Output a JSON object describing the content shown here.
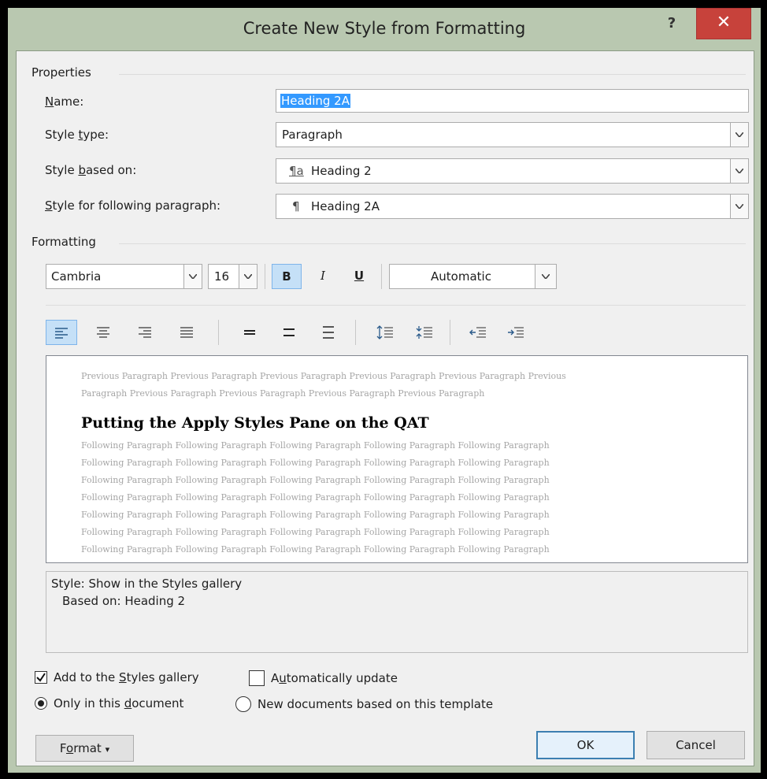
{
  "window": {
    "title": "Create New Style from Formatting",
    "help_label": "?",
    "close_label": "✕"
  },
  "properties": {
    "section_label": "Properties",
    "name_label_key": "N",
    "name_label_rest": "ame:",
    "name_value": "Heading 2A",
    "style_type_label_pre": "Style ",
    "style_type_label_key": "t",
    "style_type_label_rest": "ype:",
    "style_type_value": "Paragraph",
    "based_on_label_pre": "Style ",
    "based_on_label_key": "b",
    "based_on_label_rest": "ased on:",
    "based_on_icon": "¶a",
    "based_on_value": "Heading 2",
    "following_label_key": "S",
    "following_label_rest": "tyle for following paragraph:",
    "following_icon": "¶",
    "following_value": "Heading 2A"
  },
  "formatting": {
    "section_label": "Formatting",
    "font_name": "Cambria",
    "font_size": "16",
    "bold_label": "B",
    "italic_label": "I",
    "underline_label": "U",
    "color_value": "Automatic",
    "align_buttons": [
      "align-left-icon",
      "align-center-icon",
      "align-right-icon",
      "justify-icon"
    ],
    "spacing_buttons": [
      "single-spacing-icon",
      "one-half-spacing-icon",
      "double-spacing-icon"
    ],
    "para_space_buttons": [
      "increase-paragraph-spacing-icon",
      "decrease-paragraph-spacing-icon"
    ],
    "indent_buttons": [
      "decrease-indent-icon",
      "increase-indent-icon"
    ]
  },
  "preview": {
    "previous_line_1": "Previous Paragraph Previous Paragraph Previous Paragraph Previous Paragraph Previous Paragraph Previous",
    "previous_line_2": "Paragraph Previous Paragraph Previous Paragraph Previous Paragraph Previous Paragraph",
    "heading": "Putting the Apply Styles Pane on the QAT",
    "following_lines": [
      "Following Paragraph Following Paragraph Following Paragraph Following Paragraph Following Paragraph",
      "Following Paragraph Following Paragraph Following Paragraph Following Paragraph Following Paragraph",
      "Following Paragraph Following Paragraph Following Paragraph Following Paragraph Following Paragraph",
      "Following Paragraph Following Paragraph Following Paragraph Following Paragraph Following Paragraph",
      "Following Paragraph Following Paragraph Following Paragraph Following Paragraph Following Paragraph",
      "Following Paragraph Following Paragraph Following Paragraph Following Paragraph Following Paragraph",
      "Following Paragraph Following Paragraph Following Paragraph Following Paragraph Following Paragraph"
    ]
  },
  "description": {
    "line_1": "Style: Show in the Styles gallery",
    "line_2": "Based on: Heading 2"
  },
  "options": {
    "add_gallery_pre": "Add to the ",
    "add_gallery_key": "S",
    "add_gallery_rest": "tyles gallery",
    "add_gallery_checked": true,
    "auto_update_pre": "A",
    "auto_update_key": "u",
    "auto_update_rest": "tomatically update",
    "auto_update_checked": false,
    "only_doc_pre": "Only in this ",
    "only_doc_key": "d",
    "only_doc_rest": "ocument",
    "only_doc_selected": true,
    "new_docs_label": "New documents based on this template",
    "new_docs_selected": false
  },
  "buttons": {
    "format_pre": "F",
    "format_key": "o",
    "format_rest": "rmat",
    "format_arrow": "▾",
    "ok": "OK",
    "cancel": "Cancel"
  },
  "colors": {
    "frame": "#b9c8b0",
    "close": "#c7423b",
    "selection": "#3399ff",
    "toggle_on": "#c5e0f7"
  }
}
